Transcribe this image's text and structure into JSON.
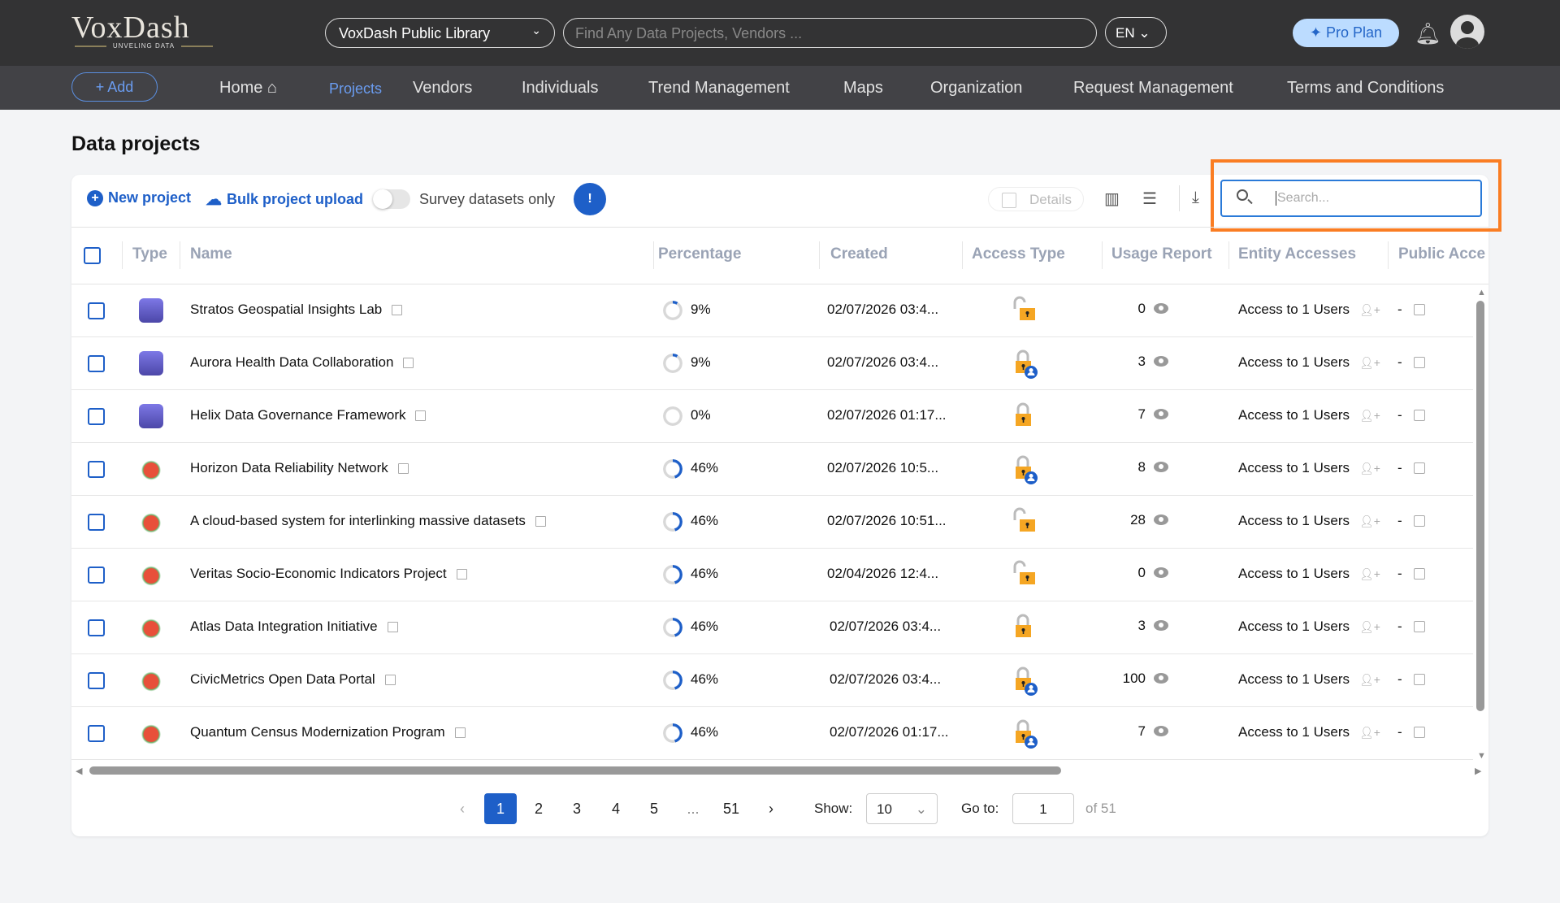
{
  "header": {
    "logo": "VoxDash",
    "logo_tagline": "UNVELING DATA",
    "library_select": "VoxDash Public Library",
    "search_placeholder": "Find Any Data Projects, Vendors ...",
    "language": "EN",
    "pro_plan": "Pro Plan"
  },
  "nav": {
    "add": "+ Add",
    "items": [
      "Home",
      "Projects",
      "Vendors",
      "Individuals",
      "Trend Management",
      "Maps",
      "Organization",
      "Request Management",
      "Terms and Conditions"
    ],
    "active": "Projects"
  },
  "page": {
    "title": "Data projects"
  },
  "toolbar": {
    "new_project": "New project",
    "bulk_upload": "Bulk project upload",
    "survey_toggle_label": "Survey datasets only",
    "survey_toggle_on": false,
    "details": "Details",
    "search_placeholder": "Search..."
  },
  "table": {
    "columns": [
      "Type",
      "Name",
      "Percentage",
      "Created",
      "Access Type",
      "Usage Report",
      "Entity Accesses",
      "Public Acce"
    ],
    "rows": [
      {
        "type": "image",
        "name": "Stratos Geospatial Insights Lab",
        "percentage": "9%",
        "pct": 9,
        "created": "02/07/2026 03:4...",
        "access": "open",
        "usage": "0",
        "entity": "Access to 1 Users",
        "public": "-"
      },
      {
        "type": "image",
        "name": "Aurora Health Data Collaboration",
        "percentage": "9%",
        "pct": 9,
        "created": "02/07/2026 03:4...",
        "access": "locked-user",
        "usage": "3",
        "entity": "Access to 1 Users",
        "public": "-"
      },
      {
        "type": "image",
        "name": "Helix Data Governance Framework",
        "percentage": "0%",
        "pct": 0,
        "created": "02/07/2026 01:17...",
        "access": "locked",
        "usage": "7",
        "entity": "Access to 1 Users",
        "public": "-"
      },
      {
        "type": "logo",
        "name": "Horizon Data Reliability Network",
        "percentage": "46%",
        "pct": 46,
        "created": "02/07/2026 10:5...",
        "access": "locked-user",
        "usage": "8",
        "entity": "Access to 1 Users",
        "public": "-"
      },
      {
        "type": "logo",
        "name": "A cloud-based system for interlinking massive datasets",
        "percentage": "46%",
        "pct": 46,
        "created": "02/07/2026 10:51...",
        "access": "open",
        "usage": "28",
        "entity": "Access to 1 Users",
        "public": "-"
      },
      {
        "type": "logo",
        "name": "Veritas Socio-Economic Indicators Project",
        "percentage": "46%",
        "pct": 46,
        "created": "02/04/2026 12:4...",
        "access": "open",
        "usage": "0",
        "entity": "Access to 1 Users",
        "public": "-"
      },
      {
        "type": "logo",
        "name": "Atlas Data Integration Initiative",
        "percentage": "46%",
        "pct": 46,
        "created": "02/07/2026 03:4...",
        "access": "locked",
        "usage": "3",
        "entity": "Access to 1 Users",
        "public": "-"
      },
      {
        "type": "logo",
        "name": "CivicMetrics Open Data Portal",
        "percentage": "46%",
        "pct": 46,
        "created": "02/07/2026 03:4...",
        "access": "locked-user",
        "usage": "100",
        "entity": "Access to 1 Users",
        "public": "-"
      },
      {
        "type": "logo",
        "name": "Quantum Census Modernization Program",
        "percentage": "46%",
        "pct": 46,
        "created": "02/07/2026 01:17...",
        "access": "locked-user",
        "usage": "7",
        "entity": "Access to 1 Users",
        "public": "-"
      }
    ]
  },
  "pagination": {
    "pages": [
      "1",
      "2",
      "3",
      "4",
      "5",
      "...",
      "51"
    ],
    "current": "1",
    "show_label": "Show:",
    "show_value": "10",
    "goto_label": "Go to:",
    "goto_value": "1",
    "total": "of 51"
  },
  "colors": {
    "accent": "#1e5fc8",
    "highlight": "#fa7d23",
    "lock": "#f5a623"
  }
}
